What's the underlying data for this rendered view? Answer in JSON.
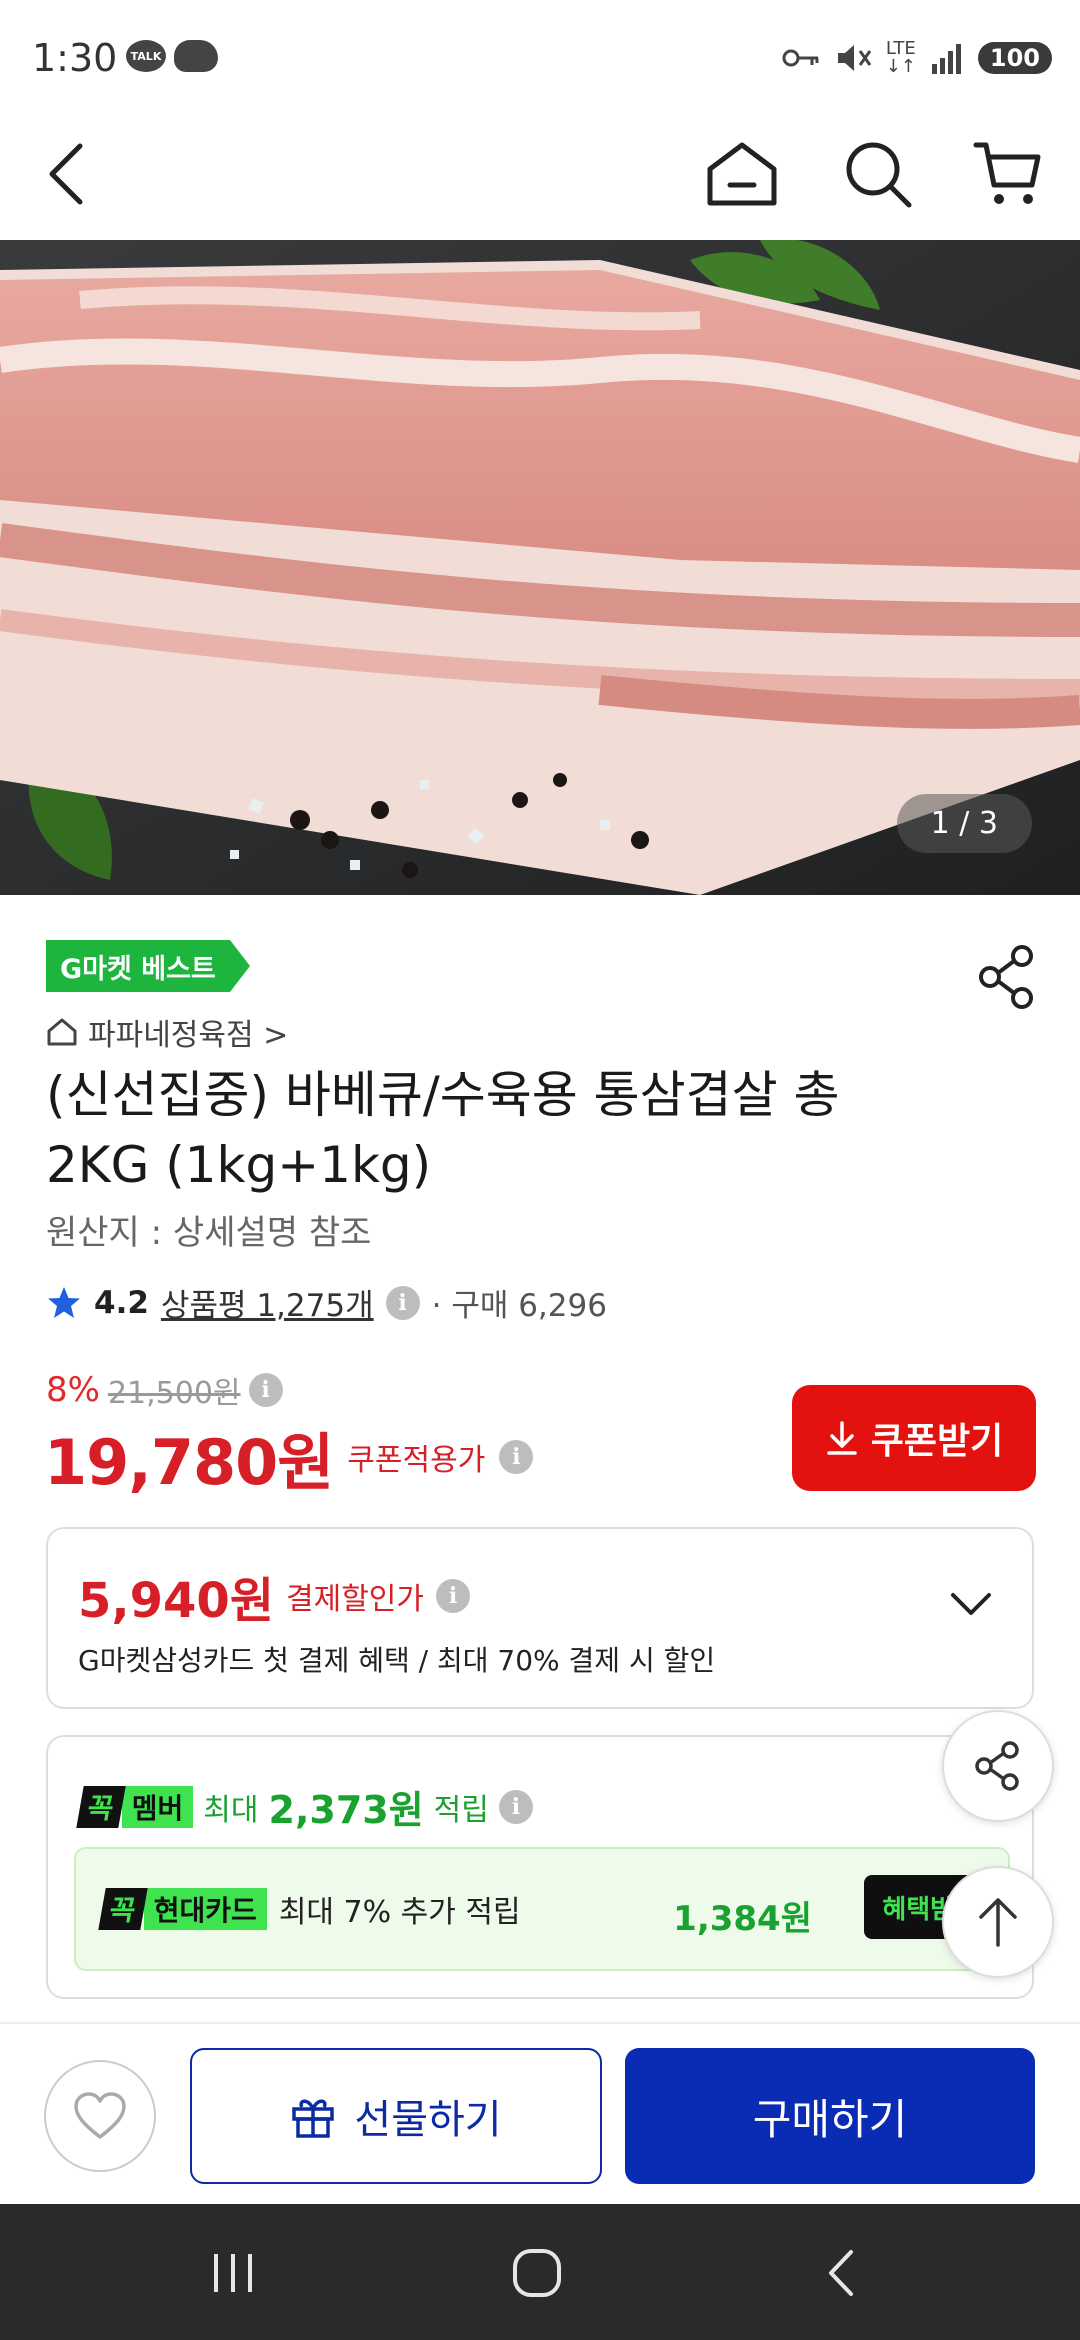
{
  "status_bar": {
    "time": "1:30",
    "talk_label": "TALK",
    "network": "LTE",
    "battery": "100"
  },
  "nav": {
    "icons": [
      "back-icon",
      "home-icon",
      "search-icon",
      "cart-icon"
    ]
  },
  "gallery": {
    "counter": "1 / 3"
  },
  "product": {
    "badge": "G마켓 베스트",
    "seller": "파파네정육점 >",
    "title": "(신선집중) 바베큐/수육용 통삼겹살 총 2KG (1kg+1kg)",
    "origin": "원산지 : 상세설명 참조",
    "rating": "4.2",
    "review_label": "상품평 1,275개",
    "purchase_label": "· 구매 6,296",
    "discount_pct": "8%",
    "original_price": "21,500원",
    "price": "19,780원",
    "price_note": "쿠폰적용가",
    "coupon_button": "쿠폰받기"
  },
  "card_discount": {
    "amount": "5,940원",
    "label": "결제할인가",
    "description": "G마켓삼성카드 첫 결제 혜택 / 최대 70% 결제 시 할인"
  },
  "membership": {
    "tag_a": "꼭",
    "tag_b": "멤버",
    "prefix": "최대",
    "amount": "2,373원",
    "suffix": "적립",
    "card_tag_a": "꼭",
    "card_tag_b": "현대카드",
    "card_text": "최대 7% 추가 적립",
    "card_amount": "1,384원",
    "card_button": "혜택받기"
  },
  "actions": {
    "gift": "선물하기",
    "buy": "구매하기"
  },
  "colors": {
    "price_red": "#d61f26",
    "coupon_red": "#e3120f",
    "brand_green": "#1db53d",
    "member_green": "#19a230",
    "buy_blue": "#0a2bb3"
  }
}
